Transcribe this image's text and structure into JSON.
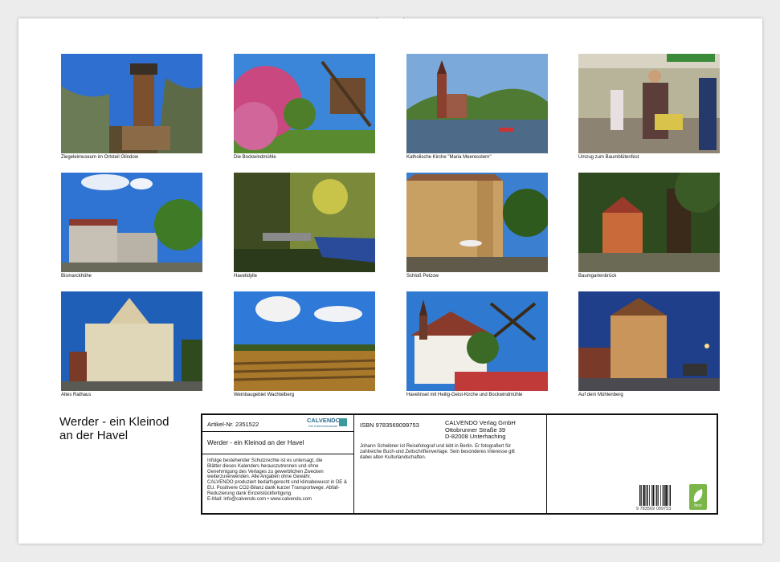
{
  "calendar": {
    "title_line1": "Werder - ein Kleinod",
    "title_line2": "an der Havel",
    "photos": [
      {
        "caption": "Ziegeleimuseum im Ortsteil Glindow"
      },
      {
        "caption": "Die Bockwindmühle"
      },
      {
        "caption": "Katholische Kirche \"Maria Meeresstern\""
      },
      {
        "caption": "Umzug zum Baumblütenfest"
      },
      {
        "caption": "Bismarckhöhe"
      },
      {
        "caption": "Havelidylle"
      },
      {
        "caption": "Schloß Petzow"
      },
      {
        "caption": "Baumgartenbrück"
      },
      {
        "caption": "Altes Rathaus"
      },
      {
        "caption": "Weinbaugebiet Wachtelberg"
      },
      {
        "caption": "Havelinsel mit Heilig-Geist-Kirche und Bockwindmühle"
      },
      {
        "caption": "Auf dem Mühlenberg"
      }
    ]
  },
  "info": {
    "article_no": "Artikel-Nr. 2351522",
    "brand": "CALVENDO",
    "brand_tagline": "Die Kalendermacher",
    "product_title": "Werder - ein Kleinod an der Havel",
    "legal_text": [
      "Infolge bestehender Schutzrechte ist es untersagt, die",
      "Blätter dieses Kalenders herauszutrennen und ohne",
      "Genehmigung des Verlages zu gewerblichen Zwecken",
      "weiterzuverwenden. Alle Angaben ohne Gewähr.",
      "CALVENDO produziert bedarfsgerecht und klimabewusst in DE &",
      "EU. Positivere CO2-Bilanz dank kurzer Transportwege. Abfall-",
      "Reduzierung dank Einzelstückfertigung.",
      "E-Mail: info@calvendo.com • www.calvendo.com"
    ],
    "isbn": "ISBN 9783569099753",
    "publisher_lines": [
      "CALVENDO Verlag GmbH",
      "Ottobrunner Straße 39",
      "D-82008 Unterhaching"
    ],
    "author_bio": [
      "Johann Scheibner ist Reisefotograf und lebt in Berlin. Er fotografiert für",
      "zahlreiche Buch-und Zeitschriftenverlage. Sein besonderes Interesse gilt",
      "dabei alten Kulturlandschaften."
    ],
    "barcode_number": "9 783569 099753",
    "eco_label": "feco"
  }
}
